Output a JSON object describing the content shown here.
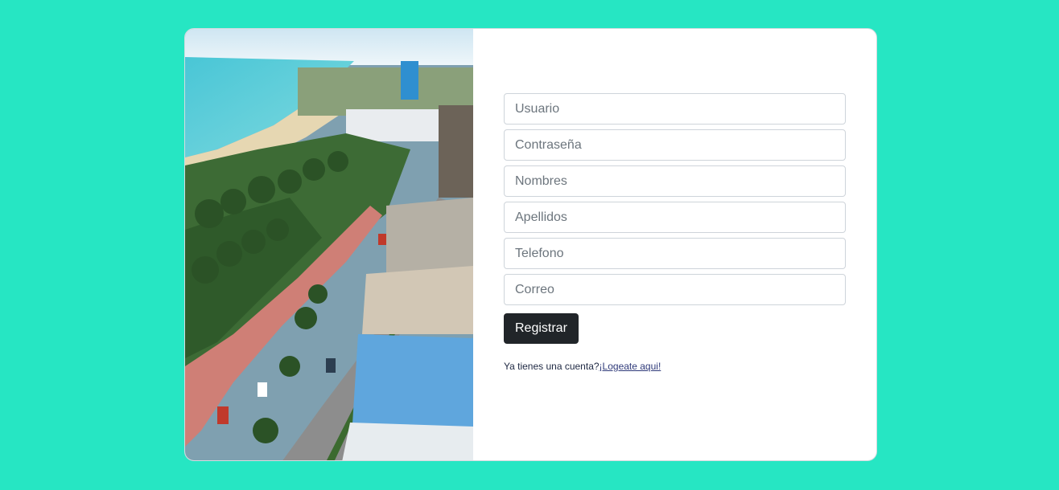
{
  "photo": {
    "description_icon": "coastal-city-photo"
  },
  "form": {
    "fields": [
      {
        "name": "usuario-input",
        "placeholder": "Usuario",
        "type": "text"
      },
      {
        "name": "contrasena-input",
        "placeholder": "Contraseña",
        "type": "password"
      },
      {
        "name": "nombres-input",
        "placeholder": "Nombres",
        "type": "text"
      },
      {
        "name": "apellidos-input",
        "placeholder": "Apellidos",
        "type": "text"
      },
      {
        "name": "telefono-input",
        "placeholder": "Telefono",
        "type": "text"
      },
      {
        "name": "correo-input",
        "placeholder": "Correo",
        "type": "email"
      }
    ],
    "submit_label": "Registrar",
    "login_prompt": "Ya tienes una cuenta?",
    "login_link": "¡Logeate aqui!"
  },
  "colors": {
    "background": "#26e6c3",
    "button": "#212529",
    "link": "#2f3a7a"
  }
}
